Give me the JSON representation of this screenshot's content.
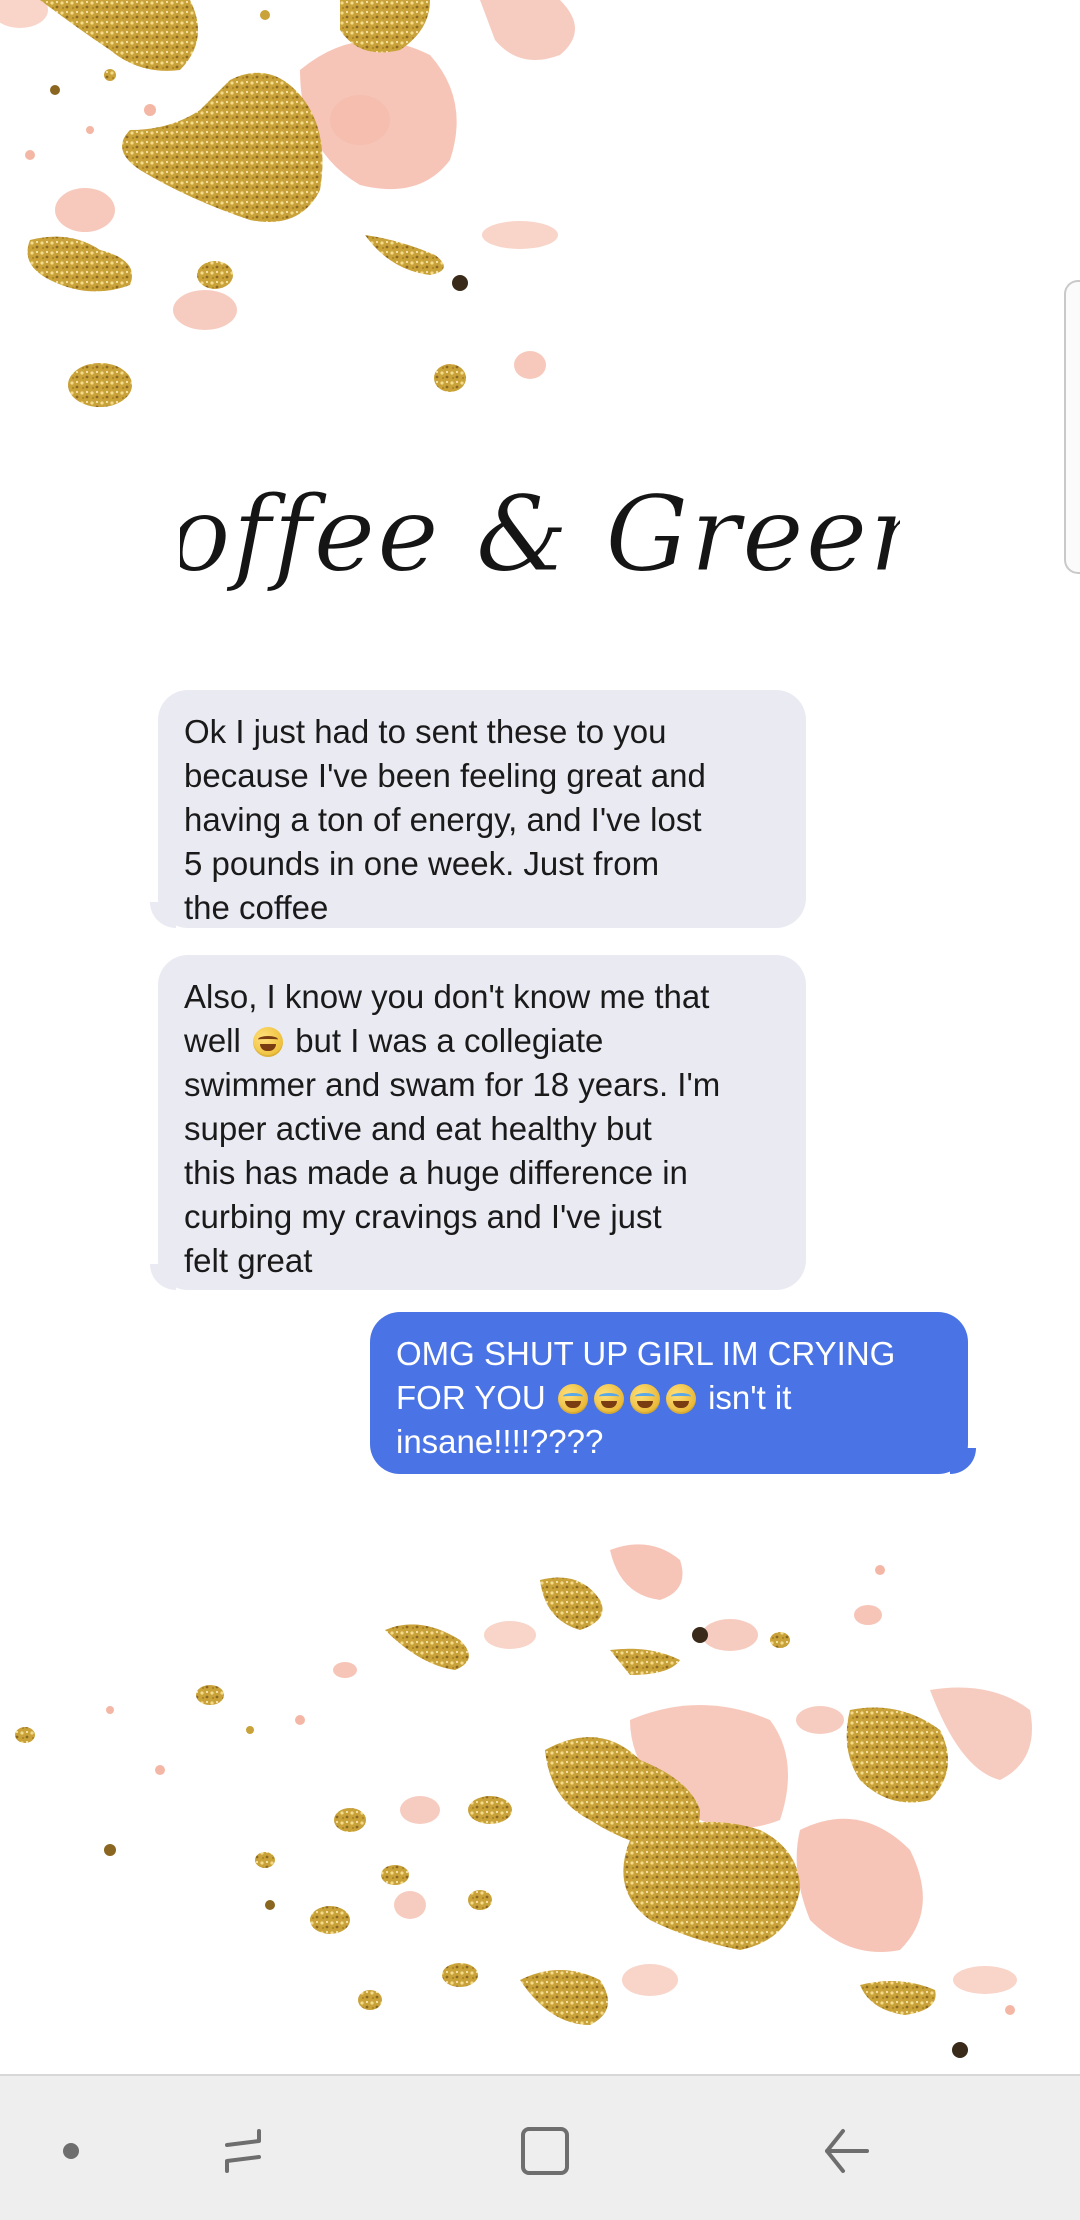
{
  "logo": {
    "text": "Coffee & Greens"
  },
  "messages": [
    {
      "direction": "incoming",
      "lines": [
        "Ok I just had to sent these to you",
        "because I've been feeling great and",
        "having a ton of energy, and I've lost",
        "5 pounds in one week. Just from",
        "the coffee"
      ]
    },
    {
      "direction": "incoming",
      "line1": "Also, I know you don't know me that",
      "line2_a": "well",
      "line2_b": "but I was a collegiate",
      "lines_rest": [
        "swimmer and swam for 18 years. I'm",
        "super active and eat healthy but",
        "this has made a huge difference in",
        "curbing my cravings and I've just",
        "felt great"
      ]
    },
    {
      "direction": "outgoing",
      "line1": "OMG SHUT UP GIRL IM CRYING",
      "line2_a": "FOR YOU",
      "line2_b": "isn't it",
      "line3": "insane!!!!????"
    }
  ],
  "navbar": {
    "items": [
      "dot",
      "recent-apps",
      "home",
      "back"
    ]
  },
  "colors": {
    "incoming_bubble": "#eaeaf3",
    "outgoing_bubble": "#4a73e6",
    "gold": "#c9a23a",
    "pink": "#f4b7a5",
    "navbar": "#eeeeee"
  }
}
